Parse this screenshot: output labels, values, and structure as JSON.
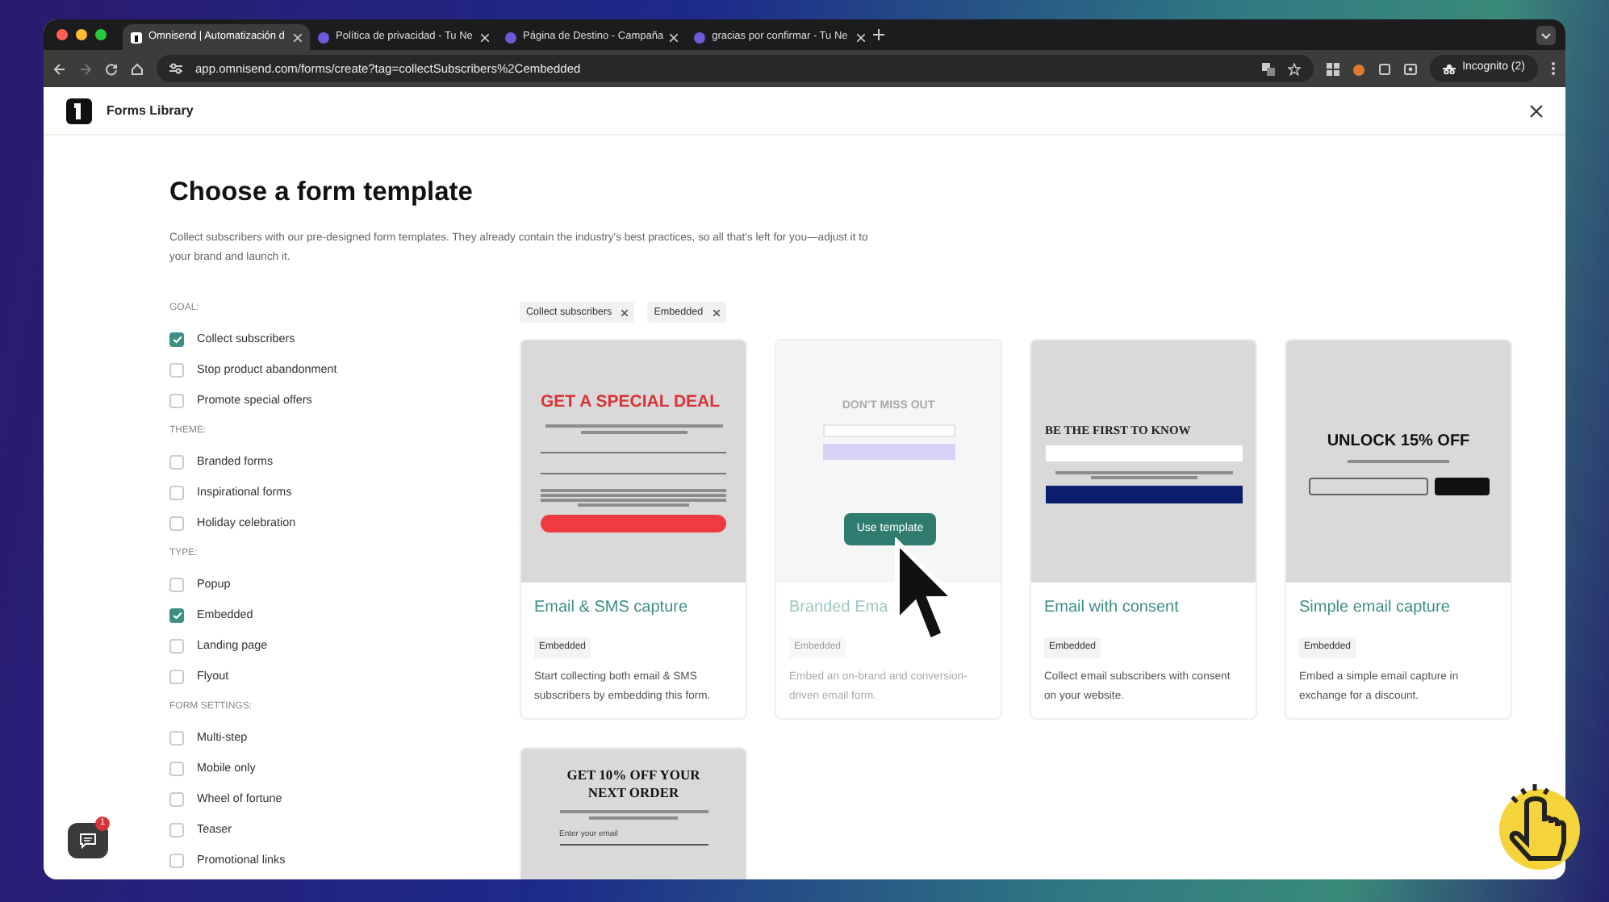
{
  "browser": {
    "tabs": [
      {
        "title": "Omnisend | Automatización d",
        "selected": true
      },
      {
        "title": "Política de privacidad - Tu Ne",
        "selected": false
      },
      {
        "title": "Página de Destino - Campaña",
        "selected": false
      },
      {
        "title": "gracias por confirmar - Tu Ne",
        "selected": false
      }
    ],
    "url": "app.omnisend.com/forms/create?tag=collectSubscribers%2Cembedded",
    "profile": "Incognito (2)"
  },
  "header": {
    "title": "Forms Library"
  },
  "page": {
    "title": "Choose a form template",
    "description": "Collect subscribers with our pre-designed form templates. They already contain the industry's best practices, so all that's left for you—adjust it to your brand and launch it."
  },
  "filters": [
    {
      "heading": "GOAL:",
      "options": [
        {
          "label": "Collect subscribers",
          "checked": true
        },
        {
          "label": "Stop product abandonment",
          "checked": false
        },
        {
          "label": "Promote special offers",
          "checked": false
        }
      ]
    },
    {
      "heading": "THEME:",
      "options": [
        {
          "label": "Branded forms",
          "checked": false
        },
        {
          "label": "Inspirational forms",
          "checked": false
        },
        {
          "label": "Holiday celebration",
          "checked": false
        }
      ]
    },
    {
      "heading": "TYPE:",
      "options": [
        {
          "label": "Popup",
          "checked": false
        },
        {
          "label": "Embedded",
          "checked": true
        },
        {
          "label": "Landing page",
          "checked": false
        },
        {
          "label": "Flyout",
          "checked": false
        }
      ]
    },
    {
      "heading": "FORM SETTINGS:",
      "options": [
        {
          "label": "Multi-step",
          "checked": false
        },
        {
          "label": "Mobile only",
          "checked": false
        },
        {
          "label": "Wheel of fortune",
          "checked": false
        },
        {
          "label": "Teaser",
          "checked": false
        },
        {
          "label": "Promotional links",
          "checked": false
        }
      ]
    }
  ],
  "active_filters": [
    {
      "label": "Collect subscribers"
    },
    {
      "label": "Embedded"
    }
  ],
  "hover_action": "Use template",
  "templates": [
    {
      "title": "Email & SMS capture",
      "tag": "Embedded",
      "description": "Start collecting both email & SMS subscribers by embedding this form.",
      "hovered": false,
      "preview": {
        "kind": "special-deal",
        "headline": "GET A SPECIAL DEAL"
      }
    },
    {
      "title": "Branded Ema",
      "tag": "Embedded",
      "description": "Embed an on-brand and conversion-driven email form.",
      "hovered": true,
      "preview": {
        "kind": "dont-miss",
        "headline": "DON'T MISS OUT"
      }
    },
    {
      "title": "Email with consent",
      "tag": "Embedded",
      "description": "Collect email subscribers with consent on your website.",
      "hovered": false,
      "preview": {
        "kind": "consent",
        "headline": "BE THE FIRST TO KNOW"
      }
    },
    {
      "title": "Simple email capture",
      "tag": "Embedded",
      "description": "Embed a simple email capture in exchange for a discount.",
      "hovered": false,
      "preview": {
        "kind": "unlock",
        "headline": "UNLOCK 15% OFF"
      }
    },
    {
      "preview": {
        "kind": "next-order",
        "headline": "GET 10% OFF YOUR NEXT ORDER",
        "field_placeholder": "Enter your email"
      }
    }
  ],
  "chat": {
    "badge": "1"
  }
}
